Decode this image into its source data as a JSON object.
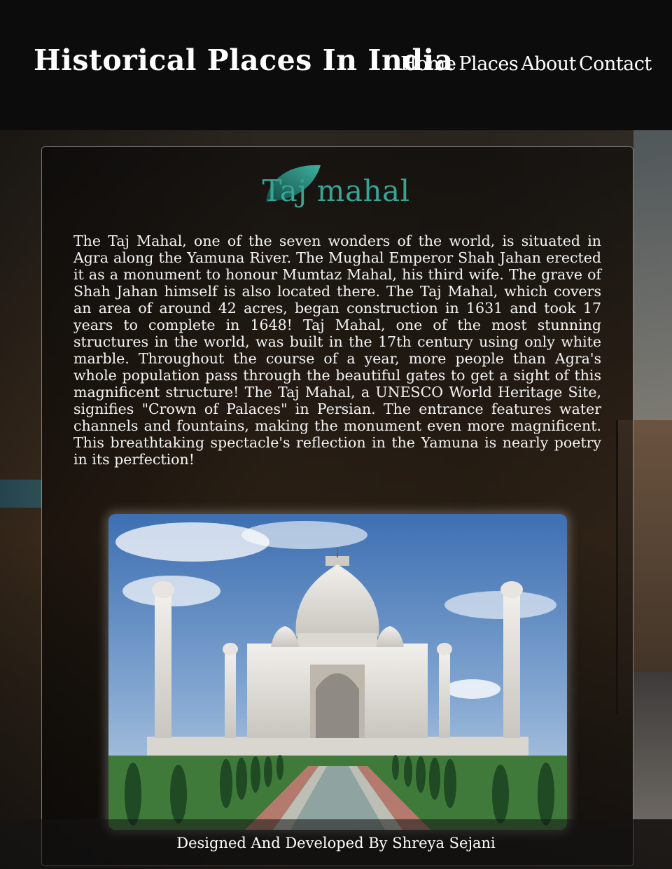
{
  "site": {
    "title": "Historical Places In India"
  },
  "nav": {
    "items": [
      "Home",
      "Places",
      "About",
      "Contact"
    ]
  },
  "place": {
    "title": "Taj mahal",
    "description": "The Taj Mahal, one of the seven wonders of the world, is situated in Agra along the Yamuna River. The Mughal Emperor Shah Jahan erected it as a monument to honour Mumtaz Mahal, his third wife. The grave of Shah Jahan himself is also located there. The Taj Mahal, which covers an area of around 42 acres, began construction in 1631 and took 17 years to complete in 1648! Taj Mahal, one of the most stunning structures in the world, was built in the 17th century using only white marble. Throughout the course of a year, more people than Agra's whole population pass through the beautiful gates to get a sight of this magnificent structure! The Taj Mahal, a UNESCO World Heritage Site, signifies \"Crown of Palaces\" in Persian. The entrance features water channels and fountains, making the monument even more magnificent. This breathtaking spectacle's reflection in the Yamuna is nearly poetry in its perfection!"
  },
  "footer": {
    "text": "Designed And Developed By Shreya Sejani"
  },
  "colors": {
    "header_bg": "#0c0c0c",
    "accent": "#3aa394",
    "text": "#f4f4f4"
  },
  "icons": {
    "title_decoration": "leaf-icon",
    "photo": "taj-mahal-photo"
  }
}
